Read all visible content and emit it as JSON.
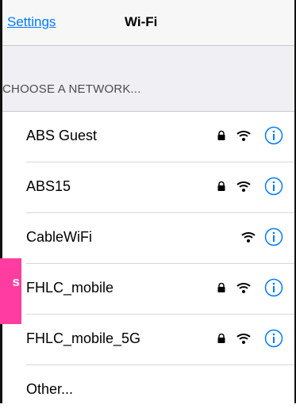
{
  "navbar": {
    "back_label": "Settings",
    "title": "Wi-Fi"
  },
  "section": {
    "header": "CHOOSE A NETWORK..."
  },
  "networks": [
    {
      "name": "ABS Guest",
      "secured": true,
      "icon": "wifi-icon"
    },
    {
      "name": "ABS15",
      "secured": true,
      "icon": "wifi-icon"
    },
    {
      "name": "CableWiFi",
      "secured": false,
      "icon": "wifi-icon"
    },
    {
      "name": "FHLC_mobile",
      "secured": true,
      "icon": "wifi-icon"
    },
    {
      "name": "FHLC_mobile_5G",
      "secured": true,
      "icon": "wifi-icon"
    }
  ],
  "other_label": "Other...",
  "overlay": {
    "text": "s",
    "color": "#ff3da0"
  },
  "colors": {
    "accent": "#007aff"
  }
}
